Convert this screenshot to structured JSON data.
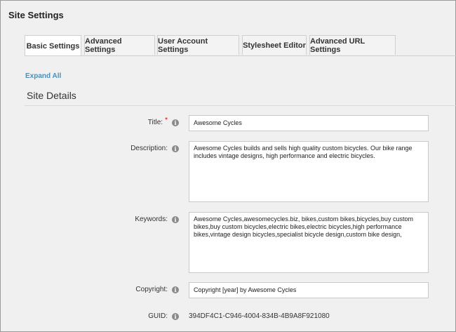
{
  "page": {
    "title": "Site Settings"
  },
  "tabs": [
    {
      "label": "Basic Settings",
      "active": true
    },
    {
      "label": "Advanced Settings",
      "active": false
    },
    {
      "label": "User Account Settings",
      "active": false
    },
    {
      "label": "Stylesheet Editor",
      "active": false
    },
    {
      "label": "Advanced URL Settings",
      "active": false
    }
  ],
  "expand_all": "Expand All",
  "section": {
    "title": "Site Details"
  },
  "fields": {
    "title": {
      "label": "Title:",
      "required_mark": "*",
      "value": "Awesome Cycles"
    },
    "description": {
      "label": "Description:",
      "value": "Awesome Cycles builds and sells high quality custom bicycles. Our bike range includes vintage designs, high performance and electric bicycles."
    },
    "keywords": {
      "label": "Keywords:",
      "value": "Awesome Cycles,awesomecycles.biz, bikes,custom bikes,bicycles,buy custom bikes,buy custom bicycles,electric bikes,electric bicycles,high performance bikes,vintage design bicycles,specialist bicycle design,custom bike design,"
    },
    "copyright": {
      "label": "Copyright:",
      "value": "Copyright [year] by Awesome Cycles"
    },
    "guid": {
      "label": "GUID:",
      "value": "394DF4C1-C946-4004-834B-4B9A8F921080"
    }
  },
  "icons": {
    "info": "info-icon"
  },
  "colors": {
    "link": "#4a90b8",
    "required": "#dd0000",
    "background": "#f0f0f0"
  }
}
